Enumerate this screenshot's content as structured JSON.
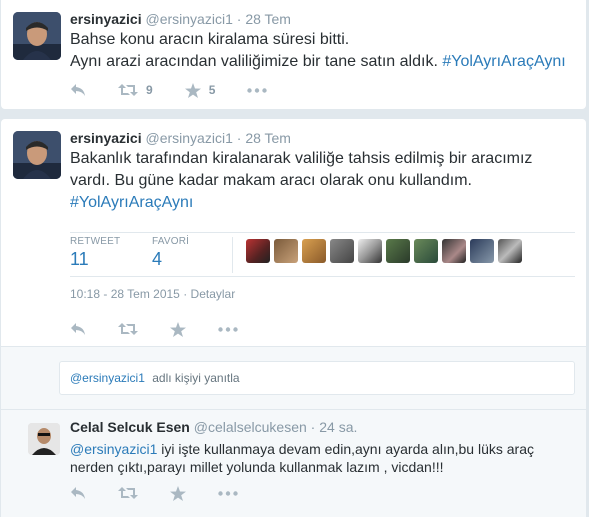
{
  "tweet1": {
    "name": "ersinyazici",
    "handle": "@ersinyazici1",
    "time": "28 Tem",
    "line1": "Bahse konu aracın kiralama süresi bitti.",
    "line2": "Aynı arazi aracından valiliğimize bir tane satın aldık.",
    "hashtag": "#YolAyrıAraçAynı",
    "retweets": "9",
    "favorites": "5"
  },
  "tweet2": {
    "name": "ersinyazici",
    "handle": "@ersinyazici1",
    "time": "28 Tem",
    "line1": "Bakanlık tarafından kiralanarak valiliğe tahsis edilmiş bir aracımız",
    "line2": "vardı. Bu güne kadar makam aracı olarak onu kullandım.",
    "hashtag": "#YolAyrıAraçAynı",
    "retweet_label": "RETWEET",
    "retweet_count": "11",
    "favorite_label": "FAVORİ",
    "favorite_count": "4",
    "timestamp": "10:18 - 28 Tem 2015",
    "details": "Detaylar"
  },
  "reply_box": {
    "mention": "@ersinyazici1",
    "placeholder": "adlı kişiyi yanıtla"
  },
  "reply": {
    "name": "Celal Selcuk Esen",
    "handle": "@celalselcukesen",
    "time": "24 sa.",
    "mention": "@ersinyazici1",
    "line1_rest": "iyi işte kullanmaya devam edin,aynı ayarda alın,bu lüks araç",
    "line2": "nerden çıktı,parayı millet yolunda kullanmak lazım , vicdan!!!"
  },
  "colors": {
    "link": "#2b7bb9",
    "muted": "#8899a6",
    "icon": "#aab8c2"
  },
  "icons": [
    "reply-icon",
    "retweet-icon",
    "star-icon",
    "more-icon"
  ]
}
